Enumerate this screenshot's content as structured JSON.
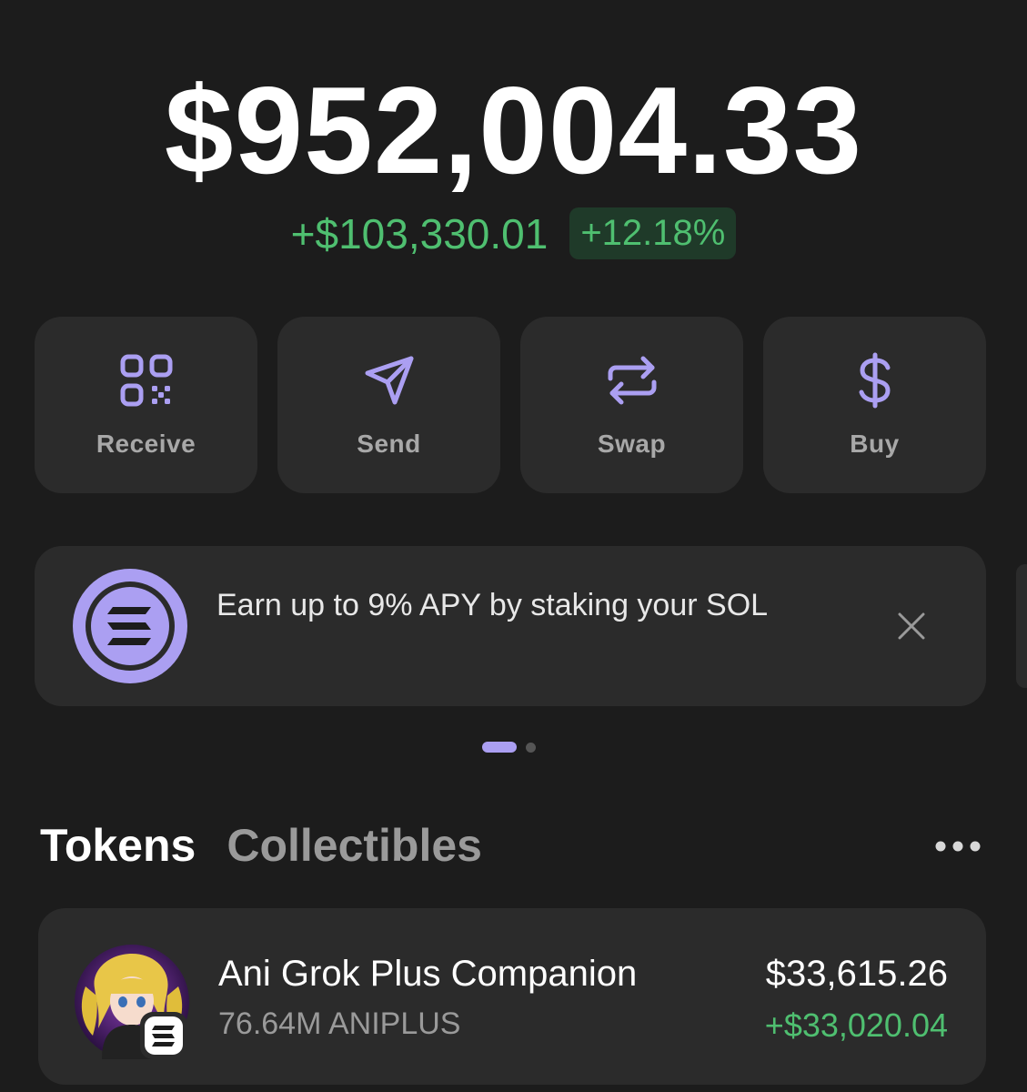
{
  "balance": {
    "total": "$952,004.33",
    "change_amount": "+$103,330.01",
    "change_percent": "+12.18%"
  },
  "actions": [
    {
      "label": "Receive",
      "icon": "qr-code-icon"
    },
    {
      "label": "Send",
      "icon": "send-icon"
    },
    {
      "label": "Swap",
      "icon": "swap-icon"
    },
    {
      "label": "Buy",
      "icon": "dollar-icon"
    }
  ],
  "banner": {
    "text": "Earn up to 9% APY by staking your SOL",
    "icon": "solana-icon",
    "close_icon": "close-icon"
  },
  "tabs": {
    "tokens": "Tokens",
    "collectibles": "Collectibles",
    "more_icon": "more-icon"
  },
  "tokens": [
    {
      "name": "Ani Grok Plus Companion",
      "amount": "76.64M ANIPLUS",
      "value": "$33,615.26",
      "change": "+$33,020.04"
    }
  ],
  "colors": {
    "background": "#1c1c1c",
    "card": "#2b2b2b",
    "accent": "#ab9ff2",
    "positive": "#4fbf70"
  }
}
